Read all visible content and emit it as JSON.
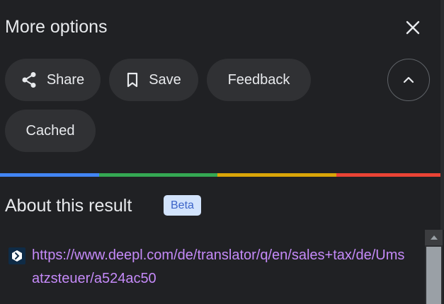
{
  "header": {
    "title": "More options",
    "close_icon": "close-icon"
  },
  "actions": {
    "share_label": "Share",
    "save_label": "Save",
    "feedback_label": "Feedback",
    "cached_label": "Cached",
    "share_icon": "share-icon",
    "save_icon": "bookmark-icon",
    "collapse_icon": "chevron-up-icon"
  },
  "colors": {
    "background": "#202124",
    "chip": "#303134",
    "link": "#c58af9",
    "google_blue": "#4285f4",
    "google_green": "#34a853",
    "google_yellow": "#fbbc04",
    "google_red": "#ea4335"
  },
  "about": {
    "title": "About this result",
    "badge": "Beta",
    "source_icon": "deepl-logo-icon",
    "url": "https://www.deepl.com/de/translator/q/en/sales+tax/de/Umsatzsteuer/a524ac50"
  }
}
